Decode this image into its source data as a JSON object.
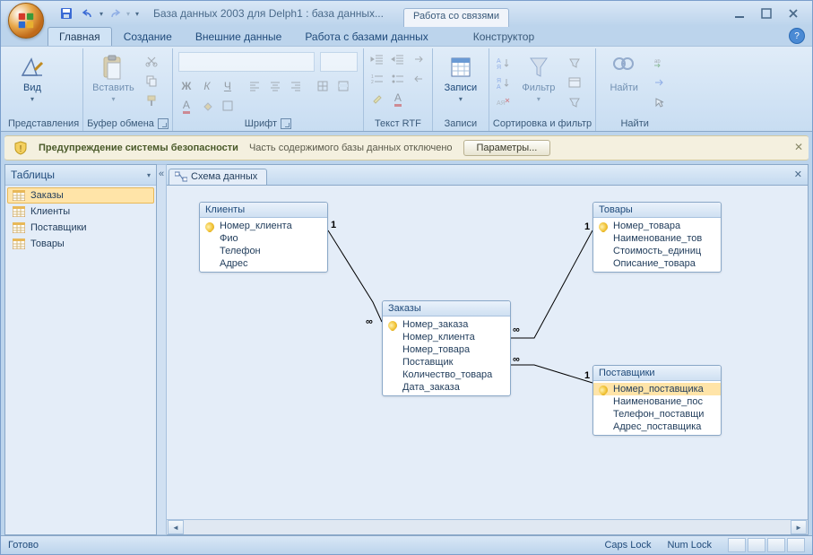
{
  "titlebar": {
    "title": "База данных 2003 для Delph1 : база данных...",
    "context_tab": "Работа со связями"
  },
  "tabs": {
    "t0": "Главная",
    "t1": "Создание",
    "t2": "Внешние данные",
    "t3": "Работа с базами данных",
    "t4": "Конструктор"
  },
  "ribbon": {
    "views": {
      "label": "Представления",
      "btn": "Вид"
    },
    "clipboard": {
      "label": "Буфер обмена",
      "btn": "Вставить"
    },
    "font": {
      "label": "Шрифт"
    },
    "rtf": {
      "label": "Текст RTF"
    },
    "records": {
      "label": "Записи",
      "btn": "Записи"
    },
    "sortfilter": {
      "label": "Сортировка и фильтр",
      "btn": "Фильтр"
    },
    "find": {
      "label": "Найти",
      "btn": "Найти"
    }
  },
  "security": {
    "title": "Предупреждение системы безопасности",
    "msg": "Часть содержимого базы данных отключено",
    "btn": "Параметры..."
  },
  "nav": {
    "header": "Таблицы",
    "items": [
      "Заказы",
      "Клиенты",
      "Поставщики",
      "Товары"
    ]
  },
  "doc_tab": "Схема данных",
  "tables": {
    "clients": {
      "title": "Клиенты",
      "fields": [
        "Номер_клиента",
        "Фио",
        "Телефон",
        "Адрес"
      ],
      "pk": [
        0
      ]
    },
    "orders": {
      "title": "Заказы",
      "fields": [
        "Номер_заказа",
        "Номер_клиента",
        "Номер_товара",
        "Поставщик",
        "Количество_товара",
        "Дата_заказа"
      ],
      "pk": [
        0
      ]
    },
    "goods": {
      "title": "Товары",
      "fields": [
        "Номер_товара",
        "Наименование_тов",
        "Стоимость_единиц",
        "Описание_товара"
      ],
      "pk": [
        0
      ]
    },
    "suppliers": {
      "title": "Поставщики",
      "fields": [
        "Номер_поставщика",
        "Наименование_пос",
        "Телефон_поставщи",
        "Адрес_поставщика"
      ],
      "pk": [
        0
      ]
    }
  },
  "status": {
    "ready": "Готово",
    "caps": "Caps Lock",
    "num": "Num Lock"
  }
}
